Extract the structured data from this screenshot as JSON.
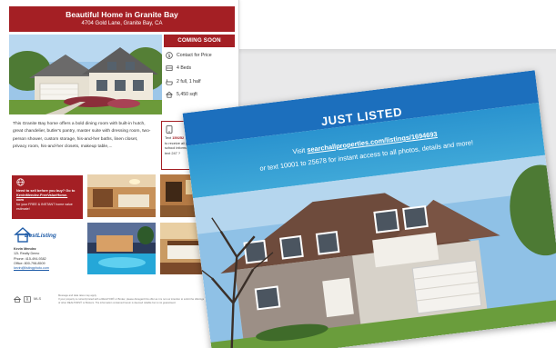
{
  "flyer": {
    "title": "Beautiful Home in Granite Bay",
    "address": "4704 Gold Lane, Granite Bay, CA",
    "status": "COMING SOON",
    "features": [
      {
        "icon": "dollar-icon",
        "label": "Contact for Price"
      },
      {
        "icon": "bed-icon",
        "label": "4 Beds"
      },
      {
        "icon": "bath-icon",
        "label": "2 full, 1 half"
      },
      {
        "icon": "house-icon",
        "label": "5,450 sqft"
      }
    ],
    "description": "This Granite Bay home offers a bold dining room with built-in hutch, great chandelier, butler's pantry, master suite with dressing room, two-person shower, custom storage, his-and-her baths, linen closet, privacy room, his-and-her closets, makeup table,...",
    "text_box": {
      "line1_prefix": "Text",
      "code": "159252",
      "line2": "to receive all photos,",
      "line3": "school information",
      "line4": "text 247 ?"
    },
    "sell_box": {
      "line1": "Need to sell before you buy? Go to",
      "line2": "KevinMendez.FreeValueHome.",
      "line3": "com",
      "line4": "for your FREE & INSTANT home value estimate!"
    },
    "logo_text": "BestListing",
    "agent": {
      "name": "Kevin Mendez",
      "company": "12L Realty Demo",
      "phone": "Phone: 415-494-9382",
      "office": "Office: 800-798-8509",
      "email": "kevin@listingphoto.com"
    },
    "footer": {
      "mls": "MLS",
      "fine_line1": "Message and data rates may apply.",
      "fine_line2": "If your property is currently listed with a REALTOR® or Broker, please disregard this offer as it is not our intention to solicit the offerings",
      "fine_line3": "of other REALTORS® or Brokers. The information contained herein is deemed reliable but is not guaranteed."
    }
  },
  "postcard": {
    "title": "JUST LISTED",
    "line1_prefix": "Visit",
    "url": "searchallproperties.com/listings/1694693",
    "line2": "or text 10001 to 25678 for instant access to all photos, details and more!"
  },
  "colors": {
    "flyer_red": "#a41f24",
    "card_blue_dark": "#1c6fbd",
    "card_blue_light": "#3fa8d8",
    "gray_band": "#e9e9ea"
  }
}
